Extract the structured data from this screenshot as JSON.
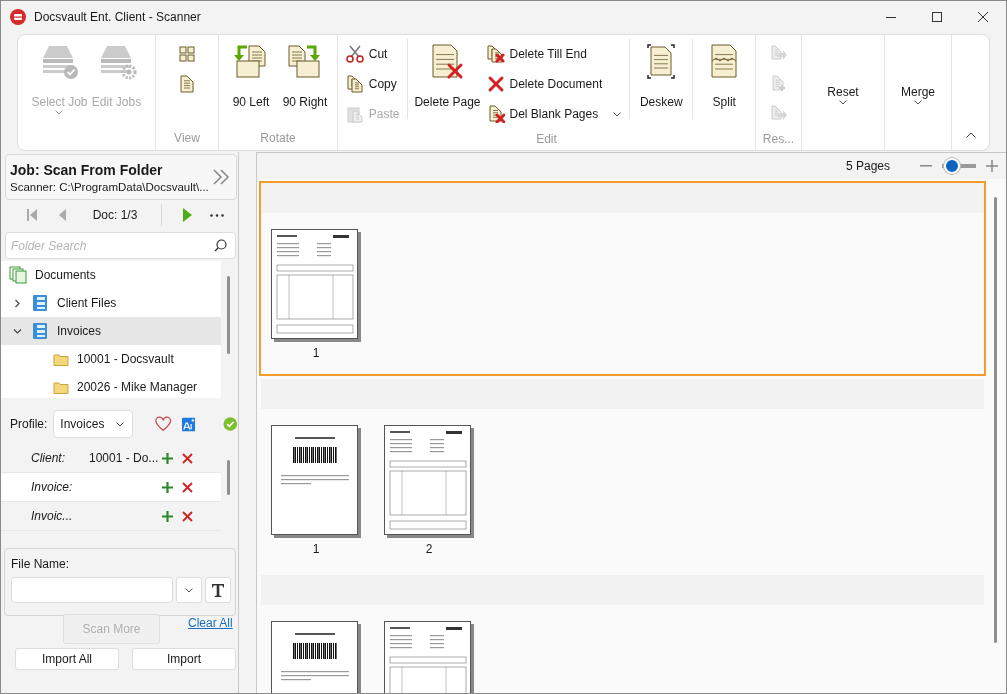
{
  "window": {
    "title": "Docsvault Ent. Client - Scanner"
  },
  "ribbon": {
    "groups": [
      {
        "items": [
          {
            "kind": "large",
            "label": "Select Job",
            "disabled": true,
            "dropdown": true
          },
          {
            "kind": "large",
            "label": "Edit Jobs",
            "disabled": true
          }
        ]
      },
      {
        "label": "View",
        "items": [
          {
            "kind": "stack",
            "items": [
              {
                "kind": "icon",
                "disabled": false
              },
              {
                "kind": "icon",
                "disabled": false
              }
            ]
          }
        ]
      },
      {
        "label": "Rotate",
        "items": [
          {
            "kind": "large",
            "label": "90 Left",
            "disabled": false
          },
          {
            "kind": "large",
            "label": "90 Right",
            "disabled": false
          }
        ]
      },
      {
        "label": "Edit",
        "items": [
          {
            "kind": "stack",
            "items": [
              {
                "kind": "small",
                "label": "Cut",
                "disabled": false
              },
              {
                "kind": "small",
                "label": "Copy",
                "disabled": false
              },
              {
                "kind": "small",
                "label": "Paste",
                "disabled": true
              }
            ]
          },
          {
            "kind": "separator"
          },
          {
            "kind": "large",
            "label": "Delete Page",
            "disabled": false
          },
          {
            "kind": "stack",
            "items": [
              {
                "kind": "small",
                "label": "Delete Till End",
                "disabled": false
              },
              {
                "kind": "small",
                "label": "Delete Document",
                "disabled": false
              },
              {
                "kind": "small",
                "label": "Del Blank Pages",
                "disabled": false,
                "dropdown": true
              }
            ]
          },
          {
            "kind": "separator"
          },
          {
            "kind": "large",
            "label": "Deskew",
            "disabled": false
          },
          {
            "kind": "separator"
          },
          {
            "kind": "large",
            "label": "Split",
            "disabled": false
          }
        ]
      },
      {
        "label": "Res...",
        "items": [
          {
            "kind": "stack",
            "items": [
              {
                "kind": "icon",
                "disabled": true
              },
              {
                "kind": "icon",
                "disabled": true
              },
              {
                "kind": "icon",
                "disabled": true
              }
            ]
          }
        ]
      },
      {
        "items": [
          {
            "kind": "menu",
            "label": "Reset",
            "disabled": false,
            "dropdown": true
          }
        ]
      },
      {
        "items": [
          {
            "kind": "menu",
            "label": "Merge",
            "disabled": false,
            "dropdown": true
          }
        ]
      }
    ]
  },
  "job": {
    "title": "Job: Scan From Folder",
    "scanner": "Scanner: C:\\ProgramData\\Docsvault\\..."
  },
  "navigator": {
    "doc": "Doc: 1/3"
  },
  "folder_search": {
    "placeholder": "Folder Search"
  },
  "tree": [
    {
      "label": "Documents",
      "selected": false,
      "children": [
        {
          "label": "Client Files",
          "selected": false,
          "expanded": false
        },
        {
          "label": "Invoices",
          "selected": true,
          "expanded": true,
          "children": [
            {
              "label": "10001 - Docsvault",
              "selected": false
            },
            {
              "label": "20026 - Mike Manager",
              "selected": false
            }
          ]
        }
      ]
    }
  ],
  "profile": {
    "label": "Profile:",
    "value": "Invoices",
    "fields": [
      {
        "label": "Client:",
        "value": "10001 - Do...",
        "selected": false
      },
      {
        "label": "Invoice:",
        "selected": true
      },
      {
        "label": "Invoic...",
        "selected": false
      }
    ]
  },
  "file_name": {
    "label": "File Name:"
  },
  "actions": {
    "scan_more": {
      "label": "Scan More",
      "disabled": true
    },
    "clear_all": "Clear All",
    "import_all": "Import All",
    "import": "Import"
  },
  "pages_header": {
    "count": "5 Pages",
    "zoom": {
      "level": 0.3
    }
  },
  "documents": [
    {
      "selected": true,
      "pages": [
        {
          "kind": "invoice",
          "number": "1"
        }
      ]
    },
    {
      "selected": false,
      "pages": [
        {
          "kind": "barcode",
          "number": "1"
        },
        {
          "kind": "invoice",
          "number": "2"
        }
      ]
    },
    {
      "selected": false,
      "pages": [
        {
          "kind": "barcode"
        },
        {
          "kind": "invoice"
        }
      ]
    }
  ]
}
